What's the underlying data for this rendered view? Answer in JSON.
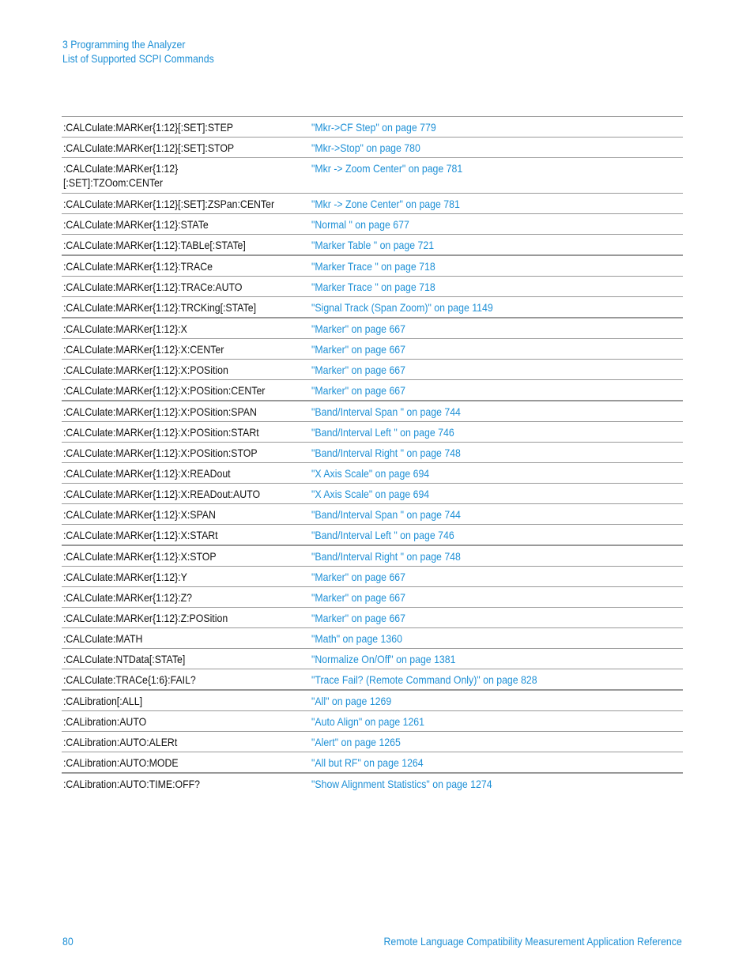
{
  "header": {
    "chapter": "3  Programming the Analyzer",
    "section": "List of Supported SCPI Commands"
  },
  "rows": [
    {
      "command": ":CALCulate:MARKer{1:12}[:SET]:STEP",
      "reference": "\"Mkr->CF Step\" on page 779"
    },
    {
      "command": ":CALCulate:MARKer{1:12}[:SET]:STOP",
      "reference": "\"Mkr->Stop\" on page 780"
    },
    {
      "command": ":CALCulate:MARKer{1:12}",
      "command_line2": "[:SET]:TZOom:CENTer",
      "reference": "\"Mkr -> Zoom Center\" on page 781"
    },
    {
      "command": ":CALCulate:MARKer{1:12}[:SET]:ZSPan:CENTer",
      "reference": "\"Mkr -> Zone Center\" on page 781"
    },
    {
      "command": ":CALCulate:MARKer{1:12}:STATe",
      "reference": "\"Normal \" on page 677"
    },
    {
      "command": ":CALCulate:MARKer{1:12}:TABLe[:STATe]",
      "reference": "\"Marker Table \" on page 721"
    },
    {
      "command": ":CALCulate:MARKer{1:12}:TRACe",
      "reference": "\"Marker Trace \" on page 718"
    },
    {
      "command": ":CALCulate:MARKer{1:12}:TRACe:AUTO",
      "reference": "\"Marker Trace \" on page 718"
    },
    {
      "command": ":CALCulate:MARKer{1:12}:TRCKing[:STATe]",
      "reference": "\"Signal Track (Span Zoom)\" on page 1149"
    },
    {
      "command": ":CALCulate:MARKer{1:12}:X",
      "reference": "\"Marker\" on page 667"
    },
    {
      "command": ":CALCulate:MARKer{1:12}:X:CENTer",
      "reference": "\"Marker\" on page 667"
    },
    {
      "command": ":CALCulate:MARKer{1:12}:X:POSition",
      "reference": "\"Marker\" on page 667"
    },
    {
      "command": ":CALCulate:MARKer{1:12}:X:POSition:CENTer",
      "reference": "\"Marker\" on page 667"
    },
    {
      "command": ":CALCulate:MARKer{1:12}:X:POSition:SPAN",
      "reference": "\"Band/Interval Span \" on page 744"
    },
    {
      "command": ":CALCulate:MARKer{1:12}:X:POSition:STARt",
      "reference": "\"Band/Interval Left \" on page 746"
    },
    {
      "command": ":CALCulate:MARKer{1:12}:X:POSition:STOP",
      "reference": "\"Band/Interval Right \" on page 748"
    },
    {
      "command": ":CALCulate:MARKer{1:12}:X:READout",
      "reference": "\"X Axis Scale\" on page 694"
    },
    {
      "command": ":CALCulate:MARKer{1:12}:X:READout:AUTO",
      "reference": "\"X Axis Scale\" on page 694"
    },
    {
      "command": ":CALCulate:MARKer{1:12}:X:SPAN",
      "reference": "\"Band/Interval Span \" on page 744"
    },
    {
      "command": ":CALCulate:MARKer{1:12}:X:STARt",
      "reference": "\"Band/Interval Left \" on page 746"
    },
    {
      "command": ":CALCulate:MARKer{1:12}:X:STOP",
      "reference": "\"Band/Interval Right \" on page 748"
    },
    {
      "command": ":CALCulate:MARKer{1:12}:Y",
      "reference": "\"Marker\" on page 667"
    },
    {
      "command": ":CALCulate:MARKer{1:12}:Z?",
      "reference": "\"Marker\" on page 667"
    },
    {
      "command": ":CALCulate:MARKer{1:12}:Z:POSition",
      "reference": "\"Marker\" on page 667"
    },
    {
      "command": ":CALCulate:MATH",
      "reference": "\"Math\" on page 1360"
    },
    {
      "command": ":CALCulate:NTData[:STATe]",
      "reference": "\"Normalize On/Off\" on page 1381"
    },
    {
      "command": ":CALCulate:TRACe{1:6}:FAIL?",
      "reference": "\"Trace Fail? (Remote Command Only)\" on page 828"
    },
    {
      "command": ":CALibration[:ALL]",
      "reference": "\"All\" on page 1269"
    },
    {
      "command": ":CALibration:AUTO",
      "reference": "\"Auto Align\" on page 1261"
    },
    {
      "command": ":CALibration:AUTO:ALERt",
      "reference": "\"Alert\" on page 1265"
    },
    {
      "command": ":CALibration:AUTO:MODE",
      "reference": "\"All but RF\" on page 1264"
    },
    {
      "command": ":CALibration:AUTO:TIME:OFF?",
      "reference": "\"Show Alignment Statistics\" on page 1274"
    }
  ],
  "footer": {
    "page_number": "80",
    "document_title": "Remote Language Compatibility Measurement Application Reference"
  },
  "colors": {
    "accent": "#1e90d6",
    "text": "#111111",
    "rule": "#999999"
  }
}
